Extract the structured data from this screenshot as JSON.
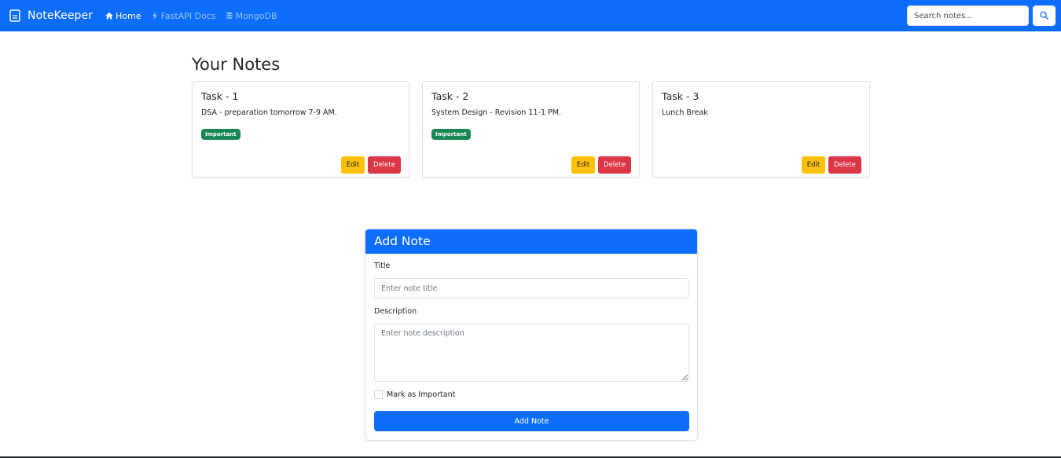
{
  "navbar": {
    "brand": "NoteKeeper",
    "links": [
      {
        "label": "Home",
        "icon": "house-icon",
        "active": true
      },
      {
        "label": "FastAPI Docs",
        "icon": "lightning-icon",
        "active": false
      },
      {
        "label": "MongoDB",
        "icon": "database-icon",
        "active": false
      }
    ],
    "search_placeholder": "Search notes...",
    "search_icon": "search-icon",
    "color": "#0d6efd"
  },
  "main": {
    "title": "Your Notes",
    "notes": [
      {
        "title": "Task - 1",
        "description": "DSA - preparation tomorrow 7-9 AM.",
        "badge": "Important",
        "edit_label": "Edit",
        "delete_label": "Delete"
      },
      {
        "title": "Task - 2",
        "description": "System Design - Revision 11-1 PM.",
        "badge": "Important",
        "edit_label": "Edit",
        "delete_label": "Delete"
      },
      {
        "title": "Task - 3",
        "description": "Lunch Break",
        "badge": "",
        "edit_label": "Edit",
        "delete_label": "Delete"
      }
    ]
  },
  "form": {
    "header": "Add Note",
    "title_label": "Title",
    "title_placeholder": "Enter note title",
    "description_label": "Description",
    "description_placeholder": "Enter note description",
    "important_label": "Mark as Important",
    "submit_label": "Add Note"
  },
  "colors": {
    "primary": "#0d6efd",
    "success": "#198754",
    "warning": "#ffc107",
    "danger": "#dc3545"
  }
}
